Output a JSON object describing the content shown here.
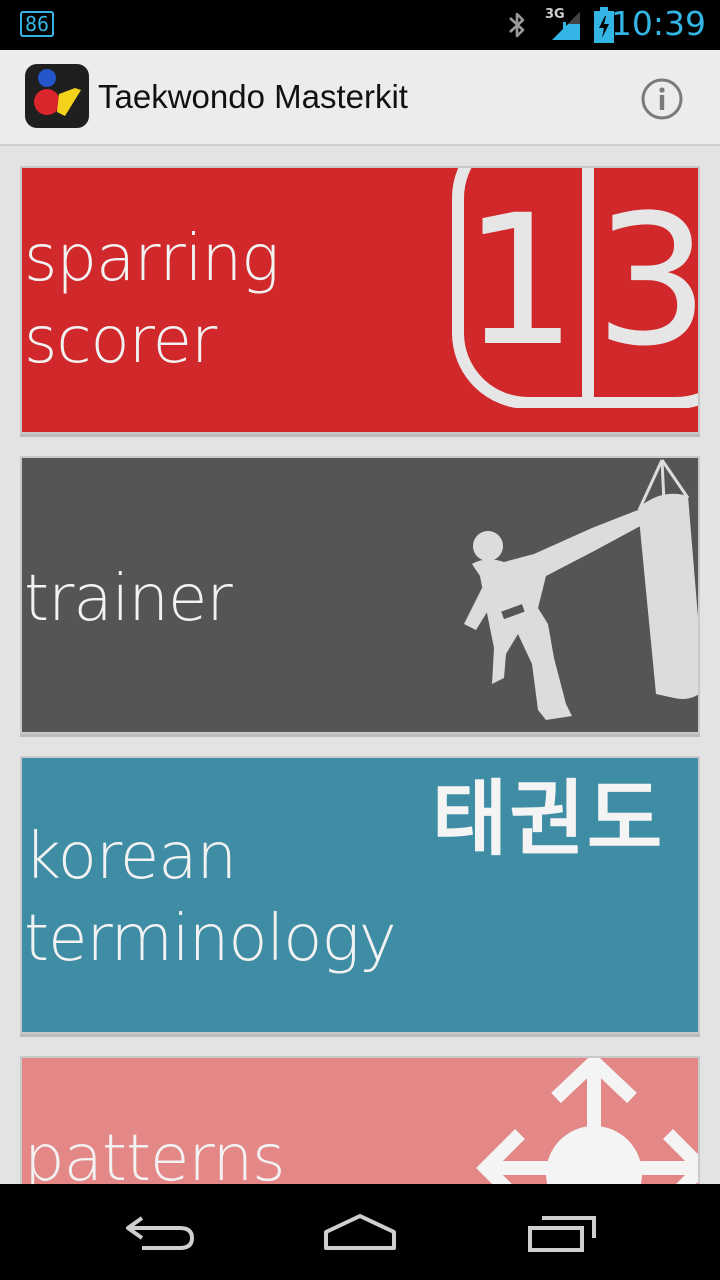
{
  "status_bar": {
    "notification_badge": "86",
    "network_type": "3G",
    "time": "10:39",
    "icons": [
      "bluetooth-icon",
      "signal-icon",
      "battery-charging-icon"
    ]
  },
  "action_bar": {
    "title": "Taekwondo Masterkit",
    "app_icon": "app-logo-icon",
    "info_icon": "info-icon"
  },
  "tiles": [
    {
      "label": "sparring\nscorer",
      "color": "#d0282b",
      "art": "scoreboard-icon",
      "art_text_left": "1",
      "art_text_right": "3"
    },
    {
      "label": "trainer",
      "color": "#555555",
      "art": "kicking-bag-silhouette-icon"
    },
    {
      "label": "korean\nterminology",
      "color": "#3f8ca5",
      "art": "hangul-text",
      "art_text": "태권도"
    },
    {
      "label": "patterns",
      "color": "#e38887",
      "art": "directions-arrows-icon"
    }
  ],
  "nav_bar": {
    "icons": [
      "back-icon",
      "home-icon",
      "recents-icon"
    ]
  }
}
